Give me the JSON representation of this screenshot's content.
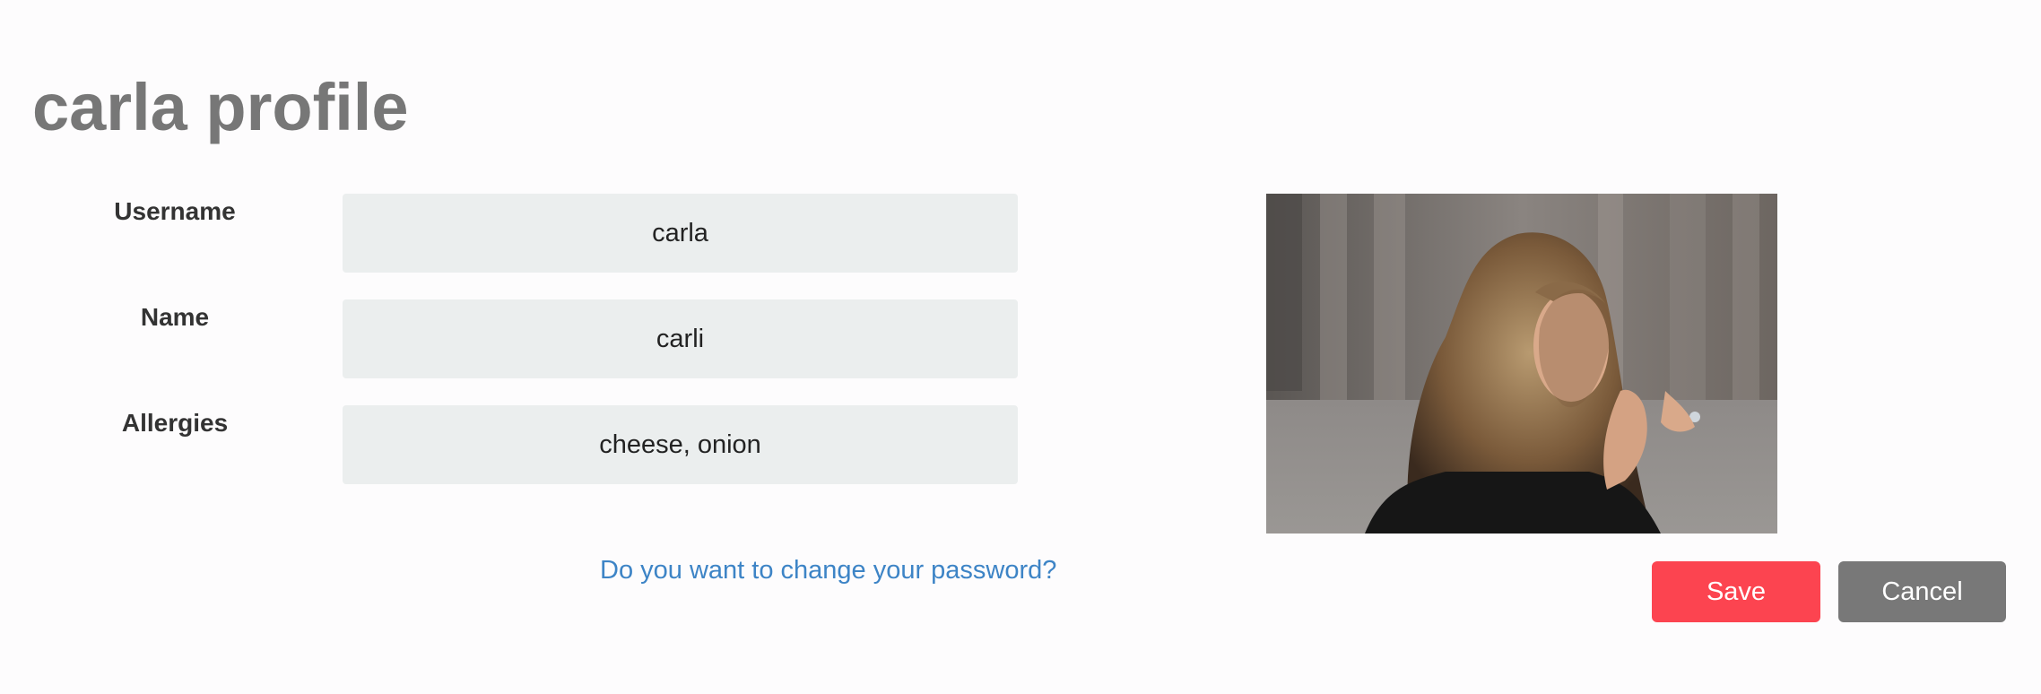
{
  "profile": {
    "title": "carla profile"
  },
  "form": {
    "username": {
      "label": "Username",
      "value": "carla"
    },
    "name": {
      "label": "Name",
      "value": "carli"
    },
    "allergies": {
      "label": "Allergies",
      "value": "cheese, onion"
    }
  },
  "links": {
    "change_password": "Do you want to change your password?"
  },
  "actions": {
    "save_label": "Save",
    "cancel_label": "Cancel"
  },
  "colors": {
    "save": "#fc4450",
    "cancel": "#787878",
    "link": "#3d84c6",
    "field_bg": "#ebeeee"
  }
}
